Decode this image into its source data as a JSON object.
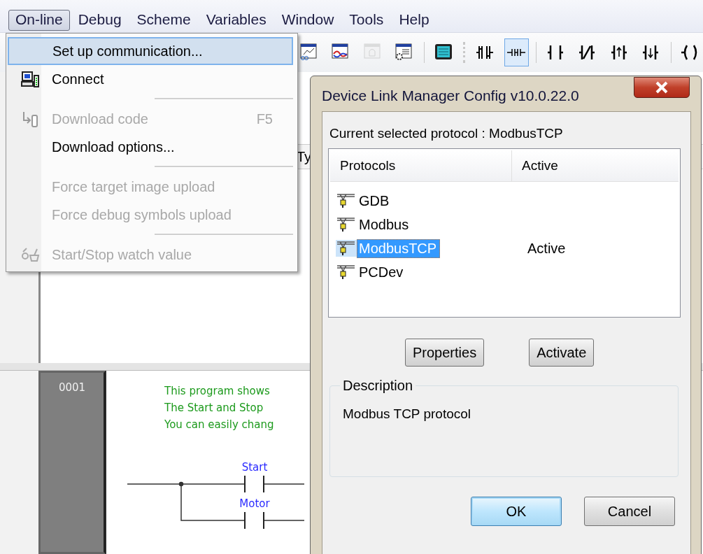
{
  "menubar": [
    {
      "label": "On-line",
      "selected": true
    },
    {
      "label": "Debug",
      "selected": false
    },
    {
      "label": "Scheme",
      "selected": false
    },
    {
      "label": "Variables",
      "selected": false
    },
    {
      "label": "Window",
      "selected": false
    },
    {
      "label": "Tools",
      "selected": false
    },
    {
      "label": "Help",
      "selected": false
    }
  ],
  "toolbar": [
    {
      "disabled": false,
      "selected": false
    },
    {
      "disabled": false,
      "selected": false
    },
    {
      "disabled": true,
      "selected": false
    },
    {
      "disabled": false,
      "selected": false
    },
    {
      "disabled": false,
      "selected": false
    },
    {
      "disabled": false,
      "selected": false
    },
    {
      "disabled": false,
      "selected": true
    },
    {
      "disabled": false,
      "selected": false
    },
    {
      "disabled": false,
      "selected": false
    },
    {
      "disabled": false,
      "selected": false
    },
    {
      "disabled": false,
      "selected": false
    },
    {
      "disabled": false,
      "selected": false
    }
  ],
  "menu": {
    "items": [
      {
        "kind": "item",
        "label": "Set up communication...",
        "selected": true,
        "disabled": false
      },
      {
        "kind": "item",
        "label": "Connect",
        "selected": false,
        "disabled": false
      },
      {
        "kind": "separator"
      },
      {
        "kind": "item",
        "label": "Download code",
        "shortcut": "F5",
        "selected": false,
        "disabled": true
      },
      {
        "kind": "item",
        "label": "Download options...",
        "selected": false,
        "disabled": false
      },
      {
        "kind": "separator"
      },
      {
        "kind": "item",
        "label": "Force target image upload",
        "selected": false,
        "disabled": true
      },
      {
        "kind": "item",
        "label": "Force debug symbols upload",
        "selected": false,
        "disabled": true
      },
      {
        "kind": "separator"
      },
      {
        "kind": "item",
        "label": "Start/Stop watch value",
        "selected": false,
        "disabled": true
      }
    ]
  },
  "panel": {
    "column_header": "Ty"
  },
  "ladder": {
    "rung_number": "0001",
    "comment_lines": [
      "This program shows",
      "The Start and Stop",
      "You can easily chang"
    ],
    "contacts": [
      {
        "label": "Start"
      },
      {
        "label": "Motor"
      }
    ]
  },
  "dialog": {
    "title": "Device Link Manager Config v10.0.22.0",
    "current_protocol": "Current selected protocol : ModbusTCP",
    "columns": [
      "Protocols",
      "Active"
    ],
    "rows": [
      {
        "name": "GDB",
        "selected": false
      },
      {
        "name": "Modbus",
        "selected": false
      },
      {
        "name": "ModbusTCP",
        "status": "Active",
        "selected": true
      },
      {
        "name": "PCDev",
        "selected": false
      }
    ],
    "actions": [
      "Properties",
      "Activate"
    ],
    "description": {
      "title": "Description",
      "text": "Modbus TCP protocol"
    },
    "buttons": [
      {
        "label": "OK",
        "default": true
      },
      {
        "label": "Cancel",
        "default": false
      }
    ]
  }
}
